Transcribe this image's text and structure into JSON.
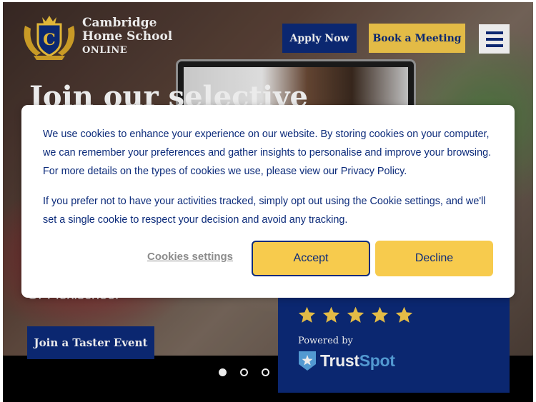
{
  "header": {
    "logo": {
      "line1": "Cambridge",
      "line2": "Home School",
      "line3": "ONLINE"
    },
    "apply_label": "Apply Now",
    "meeting_label": "Book a Meeting",
    "menu_icon": "hamburger-menu-icon"
  },
  "hero": {
    "title": "Join our selective",
    "subtitle": "Or Flexischool",
    "taster_label": "Join a Taster Event",
    "slides": {
      "count": 3,
      "active": 1
    }
  },
  "reviews": {
    "rating": 5,
    "powered_by": "Powered by",
    "brand_part1": "Trust",
    "brand_part2": "Spot"
  },
  "cookie": {
    "paragraph1": "We use cookies to enhance your experience on our website. By storing cookies on your computer, we can remember your preferences and gather insights to personalise and improve your browsing. For more details on the types of cookies we use, please view our Privacy Policy.",
    "paragraph2": "If you prefer not to have your activities tracked, simply opt out using the Cookie settings, and we'll set a single cookie to respect your decision and avoid any tracking.",
    "settings_label": "Cookies settings",
    "accept_label": "Accept",
    "decline_label": "Decline"
  },
  "colors": {
    "navy": "#0c2b7a",
    "gold": "#f7cb4d",
    "trustspot_blue": "#5aa6e3"
  }
}
